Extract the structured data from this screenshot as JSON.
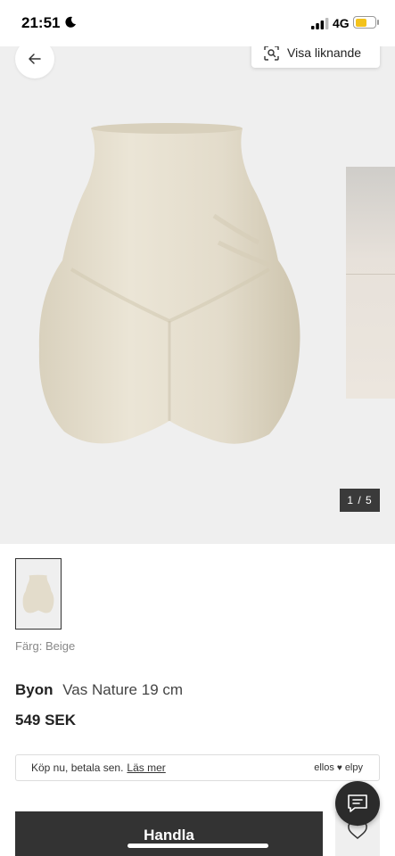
{
  "status_bar": {
    "time": "21:51",
    "network": "4G"
  },
  "gallery": {
    "similar_label": "Visa liknande",
    "counter": "1 / 5"
  },
  "product": {
    "color_label": "Färg: Beige",
    "brand": "Byon",
    "title": "Vas Nature 19 cm",
    "price": "549 SEK"
  },
  "klarna": {
    "text": "Köp nu, betala sen.",
    "link": "Läs mer",
    "logo_ellos": "ellos",
    "logo_elpy": "elpy"
  },
  "actions": {
    "buy_label": "Handla"
  },
  "icons": [
    "moon-icon",
    "signal-icon",
    "battery-icon",
    "back-arrow-icon",
    "visual-search-icon",
    "chat-icon",
    "heart-icon"
  ],
  "colors": {
    "accent_dark": "#333333",
    "gallery_bg": "#efefef",
    "battery": "#f3c21b",
    "vase": "#e3dccb"
  }
}
